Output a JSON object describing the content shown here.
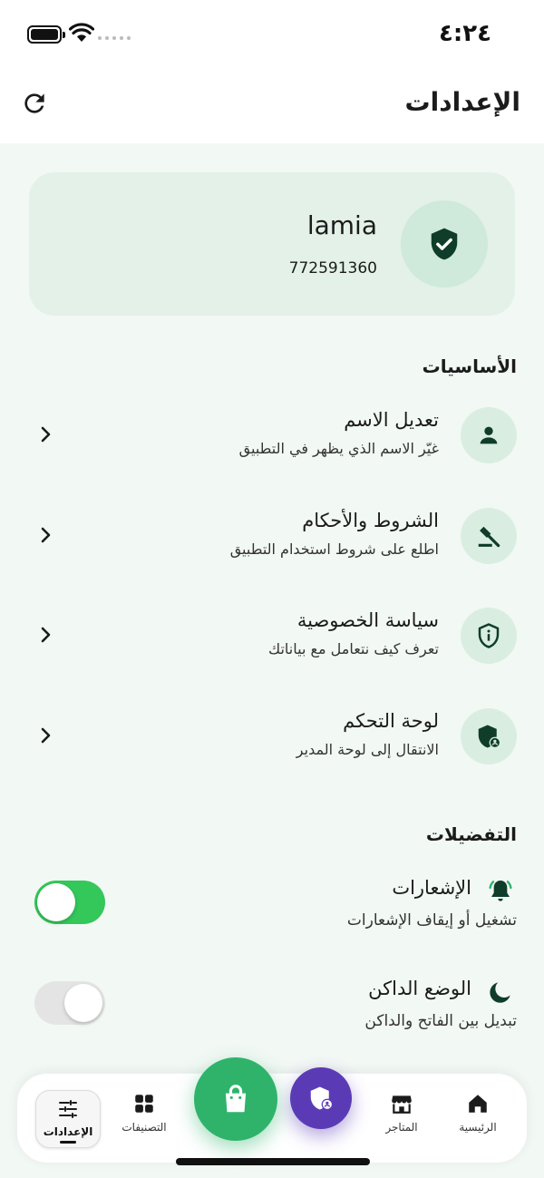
{
  "status_bar": {
    "time": "٤:٢٤"
  },
  "header": {
    "title": "الإعدادات",
    "refresh_icon": "refresh-icon"
  },
  "profile": {
    "name": "lamia",
    "phone": "772591360",
    "icon": "shield-check-icon"
  },
  "basics": {
    "title": "الأساسيات",
    "items": [
      {
        "title": "تعديل الاسم",
        "subtitle": "غيّر الاسم الذي يظهر في التطبيق",
        "icon": "person-icon"
      },
      {
        "title": "الشروط والأحكام",
        "subtitle": "اطلع على شروط استخدام التطبيق",
        "icon": "gavel-icon"
      },
      {
        "title": "سياسة الخصوصية",
        "subtitle": "تعرف كيف نتعامل مع بياناتك",
        "icon": "shield-info-icon"
      },
      {
        "title": "لوحة التحكم",
        "subtitle": "الانتقال إلى لوحة المدير",
        "icon": "admin-shield-icon"
      }
    ]
  },
  "preferences": {
    "title": "التفضيلات",
    "items": [
      {
        "title": "الإشعارات",
        "subtitle": "تشغيل أو إيقاف الإشعارات",
        "icon": "bell-icon",
        "enabled": true
      },
      {
        "title": "الوضع الداكن",
        "subtitle": "تبديل بين الفاتح والداكن",
        "icon": "moon-icon",
        "enabled": false
      }
    ]
  },
  "bottom_nav": {
    "items": [
      {
        "label": "الرئيسية",
        "icon": "home-icon"
      },
      {
        "label": "المتاجر",
        "icon": "store-icon"
      },
      {
        "label": "التصنيفات",
        "icon": "grid-icon"
      },
      {
        "label": "الإعدادات",
        "icon": "sliders-icon",
        "active": true
      }
    ],
    "fab_cart_icon": "shopping-bag-icon",
    "fab_admin_icon": "admin-shield-icon"
  },
  "colors": {
    "accent_green": "#2fb36b",
    "dark_green": "#0f3d2a",
    "toggle_on": "#34c759",
    "admin_purple": "#5b3bb5",
    "background": "#f2f8f4"
  }
}
